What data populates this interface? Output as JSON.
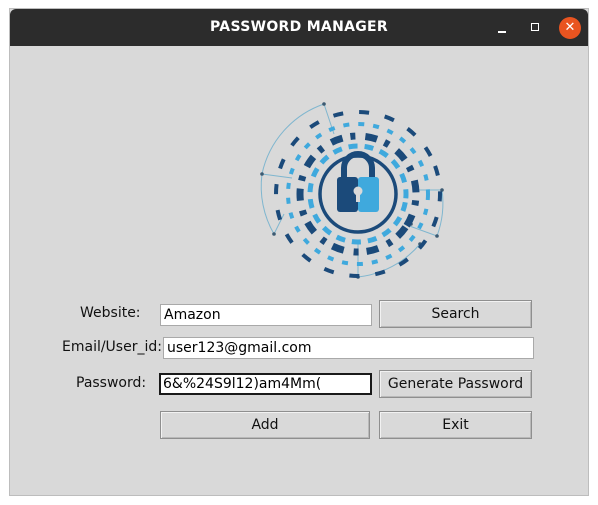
{
  "window": {
    "title": "PASSWORD MANAGER",
    "close_glyph": "✕",
    "accent_close": "#e95420",
    "titlebar_color": "#2c2c2c",
    "background": "#d9d9d9"
  },
  "logo": {
    "icon": "padlock-shield-icon",
    "colors": [
      "#1b4a7a",
      "#3fa9dd",
      "#7fb6cf"
    ]
  },
  "form": {
    "website_label": "Website:",
    "website_value": "Amazon",
    "email_label": "Email/User_id:",
    "email_value": "user123@gmail.com",
    "password_label": "Password:",
    "password_value": "6&%24S9l12)am4Mm("
  },
  "buttons": {
    "search": "Search",
    "generate": "Generate Password",
    "add": "Add",
    "exit": "Exit"
  }
}
